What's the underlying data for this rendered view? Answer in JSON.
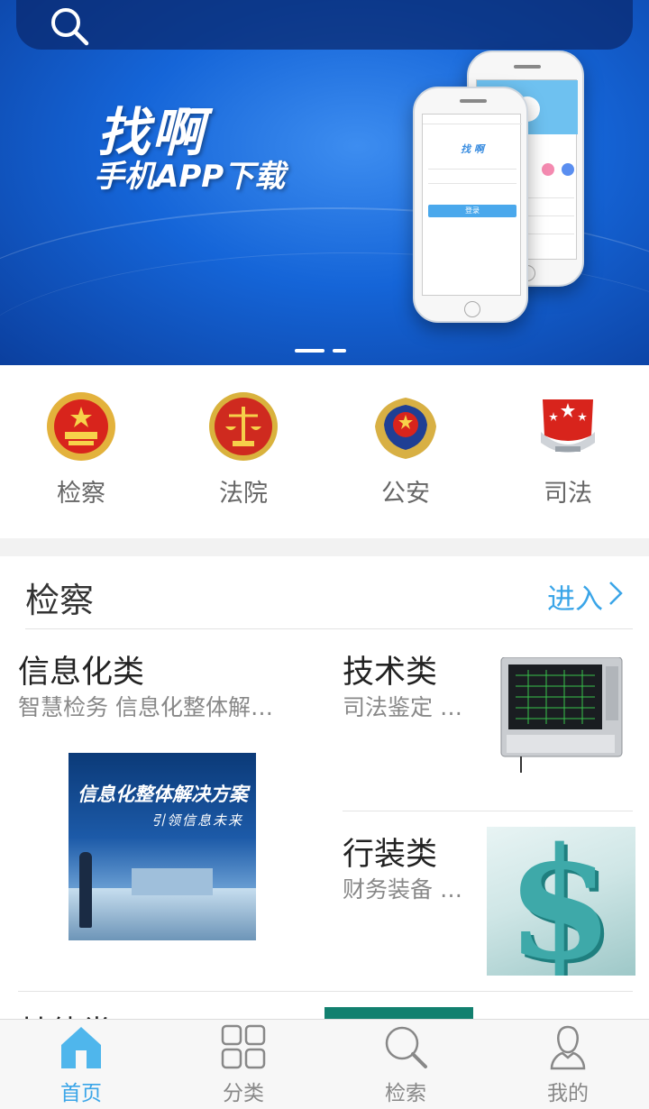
{
  "banner": {
    "title": "找啊",
    "subtitle": "手机APP下载",
    "phone_front_app_name": "找 啊",
    "phone_login_label": "登录",
    "slide_count": 2,
    "active_slide": 0
  },
  "categories": [
    {
      "label": "检察",
      "icon": "procuratorate-emblem-icon"
    },
    {
      "label": "法院",
      "icon": "court-emblem-icon"
    },
    {
      "label": "公安",
      "icon": "police-emblem-icon"
    },
    {
      "label": "司法",
      "icon": "justice-emblem-icon"
    }
  ],
  "section": {
    "title": "检察",
    "enter_label": "进入",
    "items": [
      {
        "title": "信息化类",
        "subtitle": "智慧检务  信息化整体解…"
      },
      {
        "title": "技术类",
        "subtitle": "司法鉴定  …"
      },
      {
        "title": "行装类",
        "subtitle": "财务装备  …"
      },
      {
        "title": "其他类",
        "subtitle": ""
      }
    ],
    "promo": {
      "headline": "信息化整体解决方案",
      "tagline": "引领信息未来"
    }
  },
  "tabbar": {
    "tabs": [
      {
        "label": "首页",
        "icon": "home-icon",
        "active": true
      },
      {
        "label": "分类",
        "icon": "grid-icon",
        "active": false
      },
      {
        "label": "检索",
        "icon": "search-icon",
        "active": false
      },
      {
        "label": "我的",
        "icon": "user-icon",
        "active": false
      }
    ]
  },
  "colors": {
    "accent": "#3aa5e8",
    "banner_blue": "#1565d8",
    "text_gray": "#888888"
  }
}
